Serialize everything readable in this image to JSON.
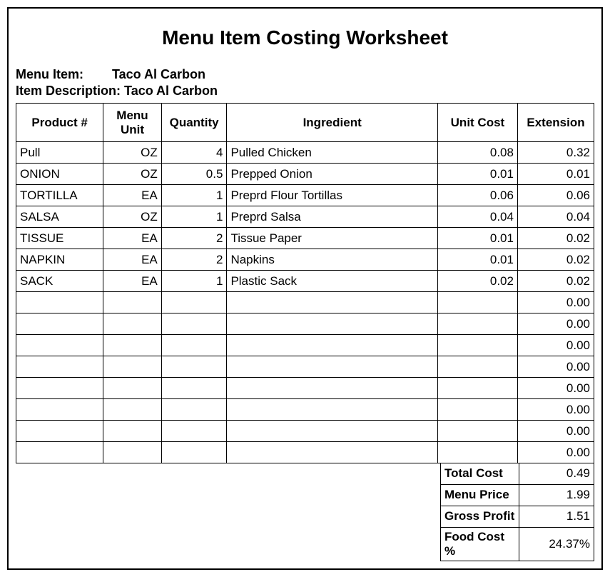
{
  "title": "Menu Item Costing Worksheet",
  "header": {
    "menu_item_label": "Menu Item:",
    "menu_item_value": "Taco Al Carbon",
    "item_description_label": "Item Description:",
    "item_description_value": "Taco Al Carbon"
  },
  "columns": {
    "product": "Product #",
    "menu_unit": "Menu Unit",
    "quantity": "Quantity",
    "ingredient": "Ingredient",
    "unit_cost": "Unit Cost",
    "extension": "Extension"
  },
  "rows": [
    {
      "product": "Pull",
      "unit": "OZ",
      "qty": "4",
      "ingredient": "Pulled Chicken",
      "unitcost": "0.08",
      "extension": "0.32"
    },
    {
      "product": "ONION",
      "unit": "OZ",
      "qty": "0.5",
      "ingredient": "Prepped Onion",
      "unitcost": "0.01",
      "extension": "0.01"
    },
    {
      "product": "TORTILLA",
      "unit": "EA",
      "qty": "1",
      "ingredient": "Preprd Flour Tortillas",
      "unitcost": "0.06",
      "extension": "0.06"
    },
    {
      "product": "SALSA",
      "unit": "OZ",
      "qty": "1",
      "ingredient": "Preprd Salsa",
      "unitcost": "0.04",
      "extension": "0.04"
    },
    {
      "product": "TISSUE",
      "unit": "EA",
      "qty": "2",
      "ingredient": "Tissue Paper",
      "unitcost": "0.01",
      "extension": "0.02"
    },
    {
      "product": "NAPKIN",
      "unit": "EA",
      "qty": "2",
      "ingredient": "Napkins",
      "unitcost": "0.01",
      "extension": "0.02"
    },
    {
      "product": "SACK",
      "unit": "EA",
      "qty": "1",
      "ingredient": "Plastic Sack",
      "unitcost": "0.02",
      "extension": "0.02"
    },
    {
      "product": "",
      "unit": "",
      "qty": "",
      "ingredient": "",
      "unitcost": "",
      "extension": "0.00"
    },
    {
      "product": "",
      "unit": "",
      "qty": "",
      "ingredient": "",
      "unitcost": "",
      "extension": "0.00"
    },
    {
      "product": "",
      "unit": "",
      "qty": "",
      "ingredient": "",
      "unitcost": "",
      "extension": "0.00"
    },
    {
      "product": "",
      "unit": "",
      "qty": "",
      "ingredient": "",
      "unitcost": "",
      "extension": "0.00"
    },
    {
      "product": "",
      "unit": "",
      "qty": "",
      "ingredient": "",
      "unitcost": "",
      "extension": "0.00"
    },
    {
      "product": "",
      "unit": "",
      "qty": "",
      "ingredient": "",
      "unitcost": "",
      "extension": "0.00"
    },
    {
      "product": "",
      "unit": "",
      "qty": "",
      "ingredient": "",
      "unitcost": "",
      "extension": "0.00"
    },
    {
      "product": "",
      "unit": "",
      "qty": "",
      "ingredient": "",
      "unitcost": "",
      "extension": "0.00"
    }
  ],
  "summary": {
    "total_cost_label": "Total Cost",
    "total_cost_value": "0.49",
    "menu_price_label": "Menu Price",
    "menu_price_value": "1.99",
    "gross_profit_label": "Gross Profit",
    "gross_profit_value": "1.51",
    "food_cost_pct_label": "Food Cost %",
    "food_cost_pct_value": "24.37%"
  }
}
